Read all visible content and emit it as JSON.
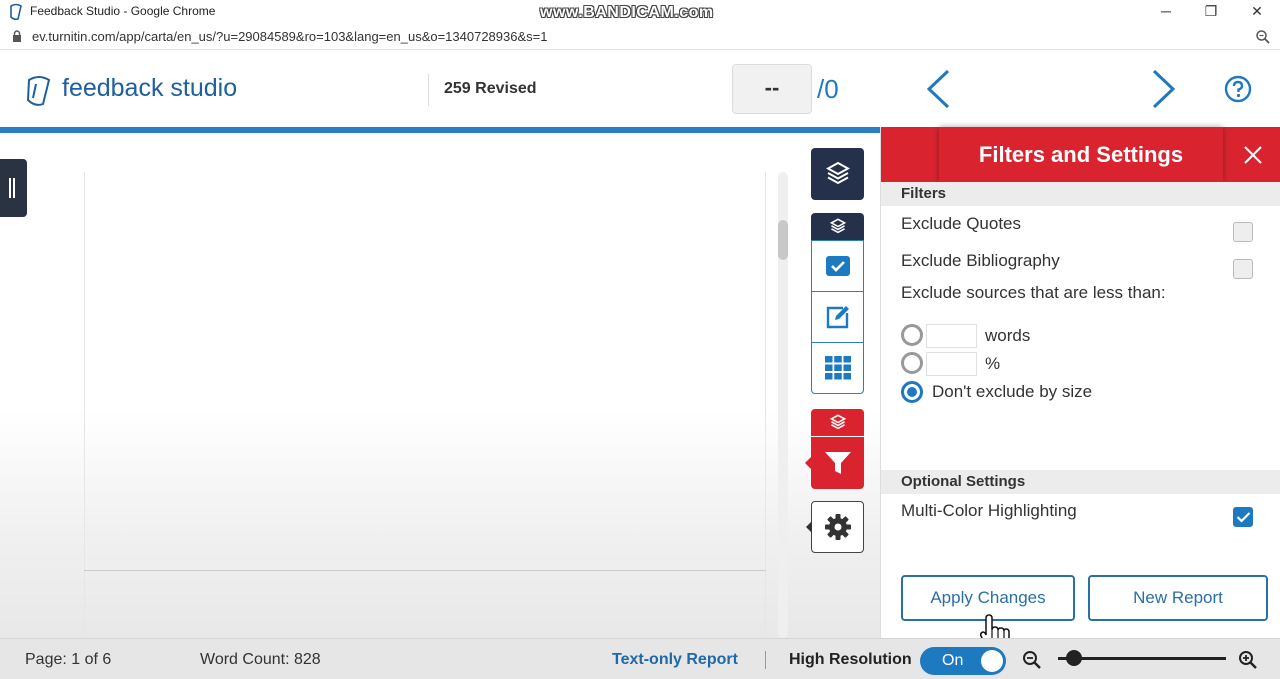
{
  "browser": {
    "window_title": "Feedback Studio - Google Chrome",
    "url": "ev.turnitin.com/app/carta/en_us/?u=29084589&ro=103&lang=en_us&o=1340728936&s=1",
    "watermark": "www.BANDICAM.com",
    "minimize_glyph": "─",
    "restore_glyph": "❐",
    "close_glyph": "✕"
  },
  "header": {
    "brand": "feedback studio",
    "submission_title": "259 Revised",
    "page_input_value": "--",
    "page_total": "/0"
  },
  "tools": {
    "icons": [
      "layers-icon",
      "checkbox-icon",
      "edit-icon",
      "grid-icon",
      "filter-icon",
      "gear-icon"
    ]
  },
  "panel": {
    "title": "Filters and Settings",
    "filters_heading": "Filters",
    "exclude_quotes": "Exclude Quotes",
    "exclude_quotes_checked": false,
    "exclude_bibliography": "Exclude Bibliography",
    "exclude_bibliography_checked": false,
    "exclude_sources_label": "Exclude sources that are less than:",
    "words_value": "",
    "words_unit": "words",
    "percent_value": "",
    "percent_unit": "%",
    "dont_exclude": "Don't exclude by size",
    "optional_heading": "Optional Settings",
    "multicolor": "Multi-Color Highlighting",
    "multicolor_checked": true,
    "apply_button": "Apply Changes",
    "new_report_button": "New Report"
  },
  "footer": {
    "page": "Page: 1 of 6",
    "word_count": "Word Count: 828",
    "text_only": "Text-only Report",
    "high_res": "High Resolution",
    "toggle_state": "On"
  },
  "colors": {
    "brand_blue": "#1e5fa0",
    "accent_blue": "#1e7ac0",
    "panel_red": "#d9242f",
    "rail_dark": "#25314a"
  }
}
